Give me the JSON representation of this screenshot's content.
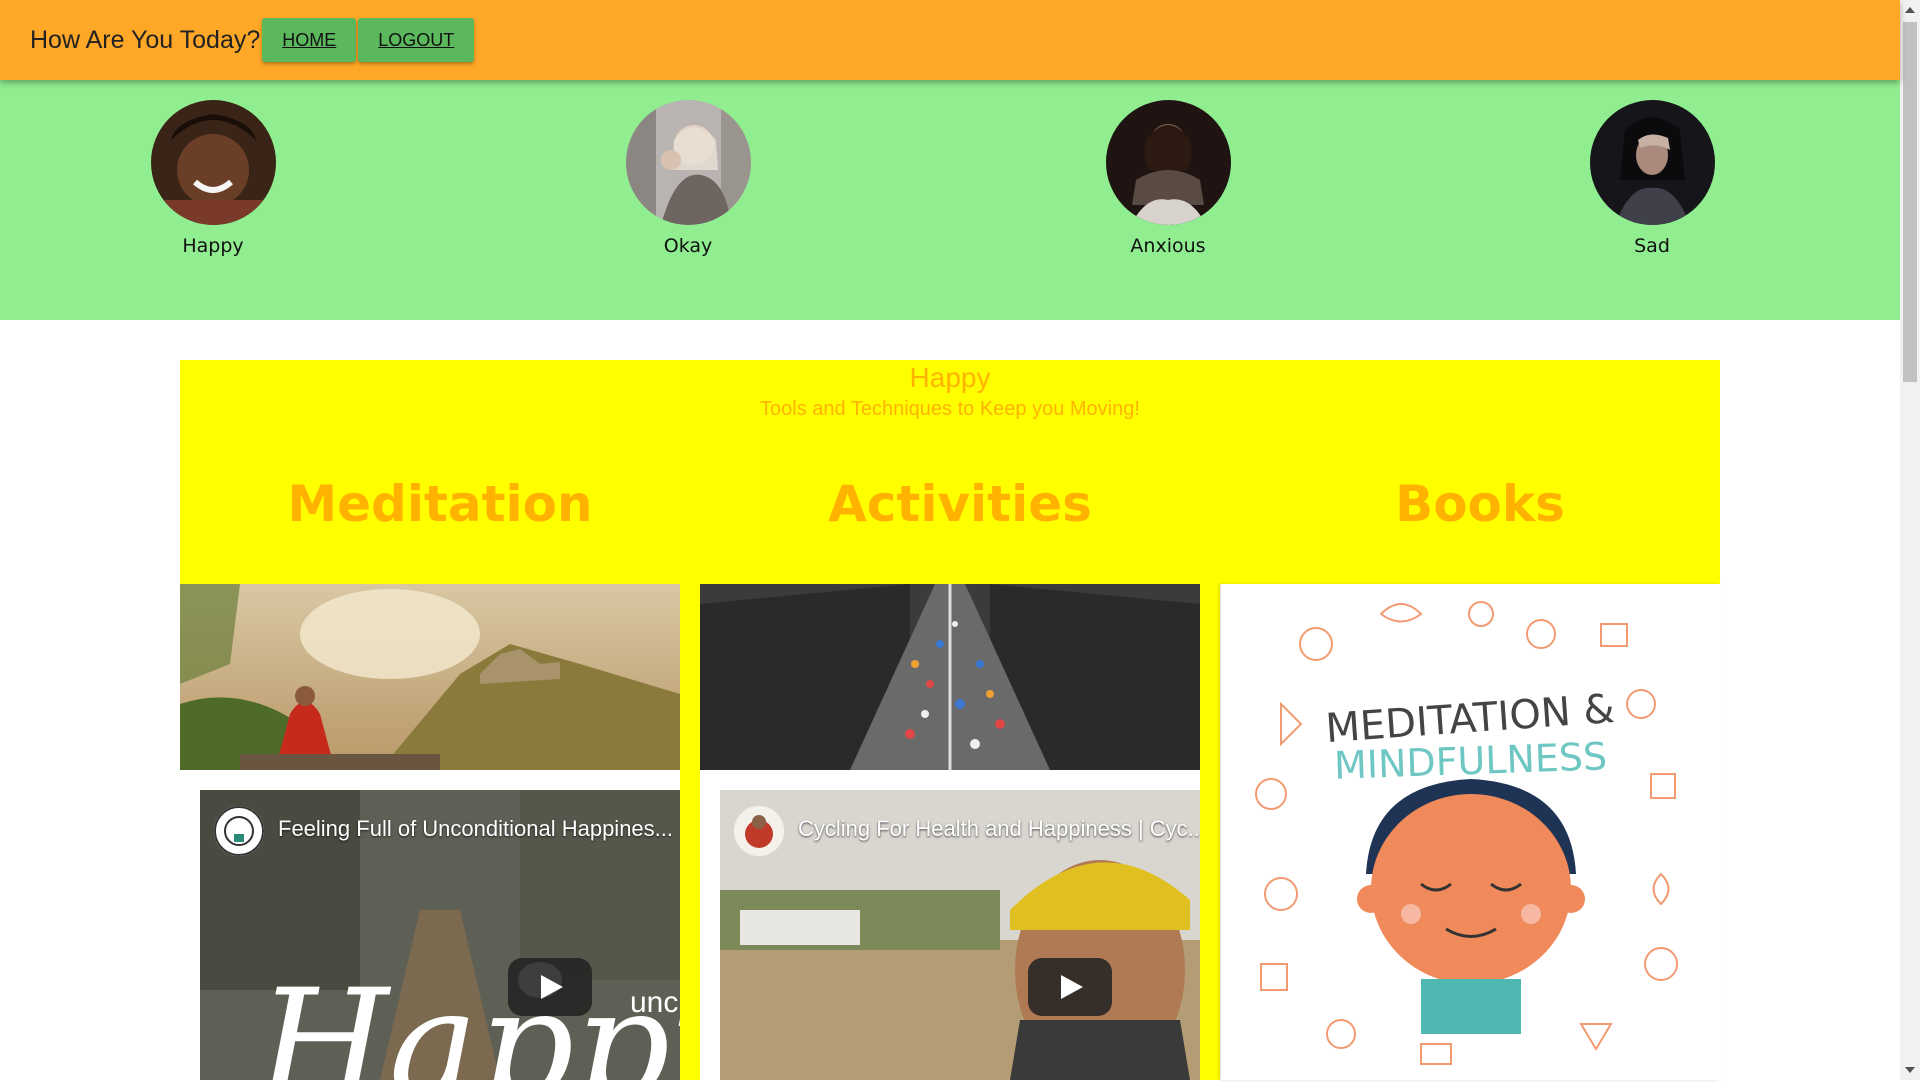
{
  "header": {
    "title": "How Are You Today?",
    "home_label": "HOME",
    "logout_label": "LOGOUT"
  },
  "moods": [
    {
      "label": "Happy",
      "icon": "happy-person-avatar"
    },
    {
      "label": "Okay",
      "icon": "okay-person-avatar"
    },
    {
      "label": "Anxious",
      "icon": "anxious-person-avatar"
    },
    {
      "label": "Sad",
      "icon": "sad-person-avatar"
    }
  ],
  "panel": {
    "title": "Happy",
    "subtitle": "Tools and Techniques to Keep you Moving!",
    "columns": [
      "Meditation",
      "Activities",
      "Books"
    ]
  },
  "videos": [
    {
      "title": "Feeling Full of Unconditional Happines...",
      "overlay_text": "unc",
      "script_text": "Happin"
    },
    {
      "title": "Cycling For Health and Happiness | Cyc..."
    }
  ],
  "book": {
    "cover_title_line1": "MEDITATION &",
    "cover_title_line2": "MINDFULNESS"
  },
  "colors": {
    "appbar": "#ffa726",
    "mood_strip": "#90ee90",
    "panel": "#ffff00",
    "accent_text": "#ffb300",
    "nav_button": "#5cb85c"
  }
}
